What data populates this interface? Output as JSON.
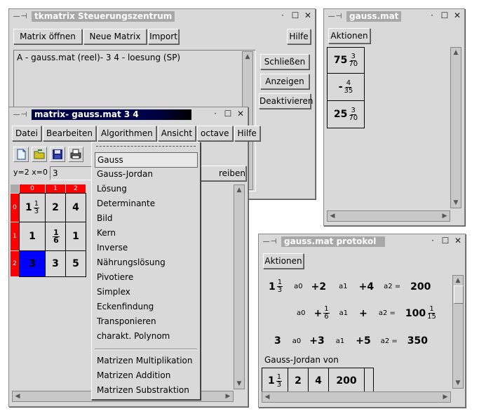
{
  "control_window": {
    "title": "tkmatrix Steuerungszentrum",
    "buttons": {
      "open": "Matrix öffnen",
      "new": "Neue Matrix",
      "import": "Import",
      "help": "Hilfe"
    },
    "list_item": "A - gauss.mat (reel)- 3 4 - loesung (SP)",
    "side_buttons": {
      "close": "Schließen",
      "show": "Anzeigen",
      "deactivate": "Deaktivieren"
    }
  },
  "gauss_window": {
    "title": "gauss.mat",
    "actions": "Aktionen",
    "values": [
      {
        "whole": "75",
        "num": "3",
        "den": "70"
      },
      {
        "sign": "-",
        "num": "4",
        "den": "35"
      },
      {
        "whole": "25",
        "num": "3",
        "den": "70"
      }
    ]
  },
  "matrix_window": {
    "title": "matrix- gauss.mat 3 4",
    "menu": [
      "Datei",
      "Bearbeiten",
      "Algorithmen",
      "Ansicht",
      "octave",
      "Hilfe"
    ],
    "position": "y=2 x=0",
    "entry_value": "3",
    "write_label": "reiben",
    "col_headers": [
      "0",
      "1",
      "2"
    ],
    "row_headers": [
      "0",
      "1",
      "2"
    ],
    "rows": [
      [
        {
          "whole": "1",
          "num": "1",
          "den": "3"
        },
        {
          "whole": "2"
        },
        {
          "whole": "4"
        }
      ],
      [
        {
          "whole": "1"
        },
        {
          "num": "1",
          "den": "6"
        },
        {
          "whole": "1"
        }
      ],
      [
        {
          "whole": "3"
        },
        {
          "whole": "3"
        },
        {
          "whole": "5"
        }
      ]
    ]
  },
  "algorithm_menu": {
    "items": [
      "Gauss",
      "Gauss-Jordan",
      "Lösung",
      "Determinante",
      "Bild",
      "Kern",
      "Inverse",
      "Nährungslösung",
      "Pivotiere",
      "Simplex",
      "Eckenfindung",
      "Transponieren",
      "charakt. Polynom"
    ],
    "items2": [
      "Matrizen Multiplikation",
      "Matrizen Addition",
      "Matrizen Substraktion"
    ],
    "selected": "Gauss"
  },
  "protocol_window": {
    "title": "gauss.mat protokol",
    "actions": "Aktionen",
    "eq1": {
      "c0w": "1",
      "c0n": "1",
      "c0d": "3",
      "a0": "a0",
      "c1": "+2",
      "a1": "a1",
      "c2": "+4",
      "a2": "a2 =",
      "rhs": "200"
    },
    "eq2": {
      "a0": "a0",
      "c1n": "1",
      "c1d": "6",
      "c1s": "+",
      "a1": "a1",
      "c2": "+",
      "a2": "a2 =",
      "rhsw": "100",
      "rhsn": "1",
      "rhsd": "15"
    },
    "eq3": {
      "c0": "3",
      "a0": "a0",
      "c1": "+3",
      "a1": "a1",
      "c2": "+5",
      "a2": "a2 =",
      "rhs": "350"
    },
    "gj_label": "Gauss-Jordan von",
    "gj_row": {
      "c0w": "1",
      "c0n": "1",
      "c0d": "3",
      "c1": "2",
      "c2": "4",
      "c3": "200"
    }
  },
  "colors": {
    "selected_cell": "#0000ff",
    "header_red": "#ff0000",
    "active_title": "#000048"
  }
}
